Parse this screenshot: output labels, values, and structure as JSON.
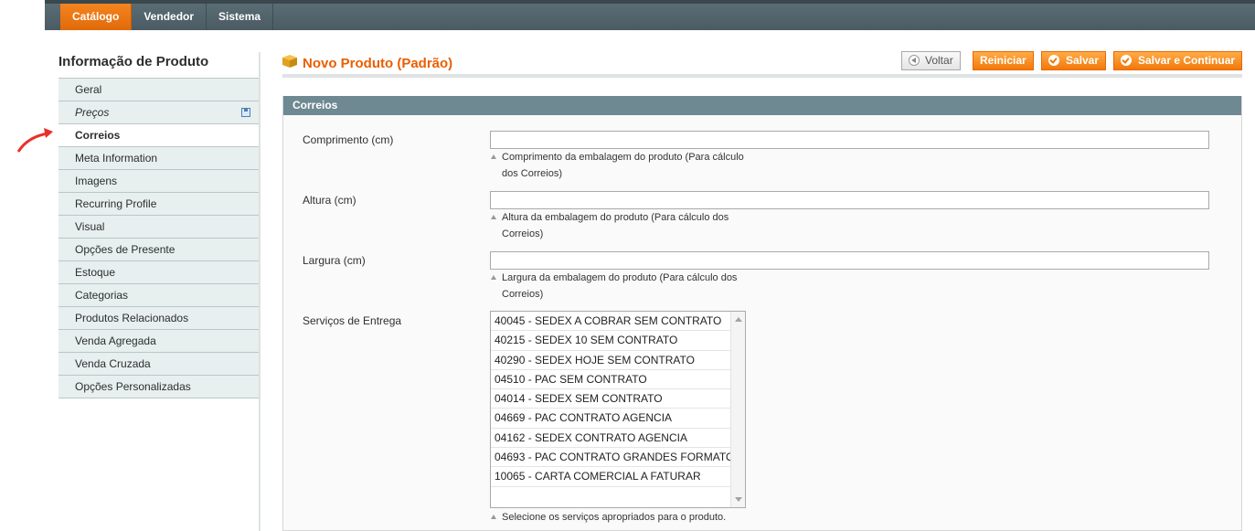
{
  "nav": {
    "items": [
      "Catálogo",
      "Vendedor",
      "Sistema"
    ]
  },
  "sidebar": {
    "title": "Informação de Produto",
    "tabs": [
      "Geral",
      "Preços",
      "Correios",
      "Meta Information",
      "Imagens",
      "Recurring Profile",
      "Visual",
      "Opções de Presente",
      "Estoque",
      "Categorias",
      "Produtos Relacionados",
      "Venda Agregada",
      "Venda Cruzada",
      "Opções Personalizadas"
    ]
  },
  "header": {
    "title": "Novo Produto (Padrão)",
    "back_label": "Voltar",
    "reset_label": "Reiniciar",
    "save_label": "Salvar",
    "save_continue_label": "Salvar e Continuar"
  },
  "section": {
    "title": "Correios",
    "length_label": "Comprimento (cm)",
    "length_note": "Comprimento da embalagem do produto (Para cálculo dos Correios)",
    "height_label": "Altura (cm)",
    "height_note": "Altura da embalagem do produto (Para cálculo dos Correios)",
    "width_label": "Largura (cm)",
    "width_note": "Largura da embalagem do produto (Para cálculo dos Correios)",
    "services_label": "Serviços de Entrega",
    "services": [
      "40045 - SEDEX A COBRAR SEM CONTRATO",
      "40215 - SEDEX 10 SEM CONTRATO",
      "40290 - SEDEX HOJE SEM CONTRATO",
      "04510 - PAC SEM CONTRATO",
      "04014 - SEDEX SEM CONTRATO",
      "04669 - PAC CONTRATO AGENCIA",
      "04162 - SEDEX CONTRATO AGENCIA",
      "04693 - PAC CONTRATO GRANDES FORMATOS",
      "10065 - CARTA COMERCIAL A FATURAR"
    ],
    "services_note": "Selecione os serviços apropriados para o produto."
  },
  "colors": {
    "accent": "#eb5e00",
    "nav_bg": "#4f6068",
    "section_head": "#6f8992"
  }
}
